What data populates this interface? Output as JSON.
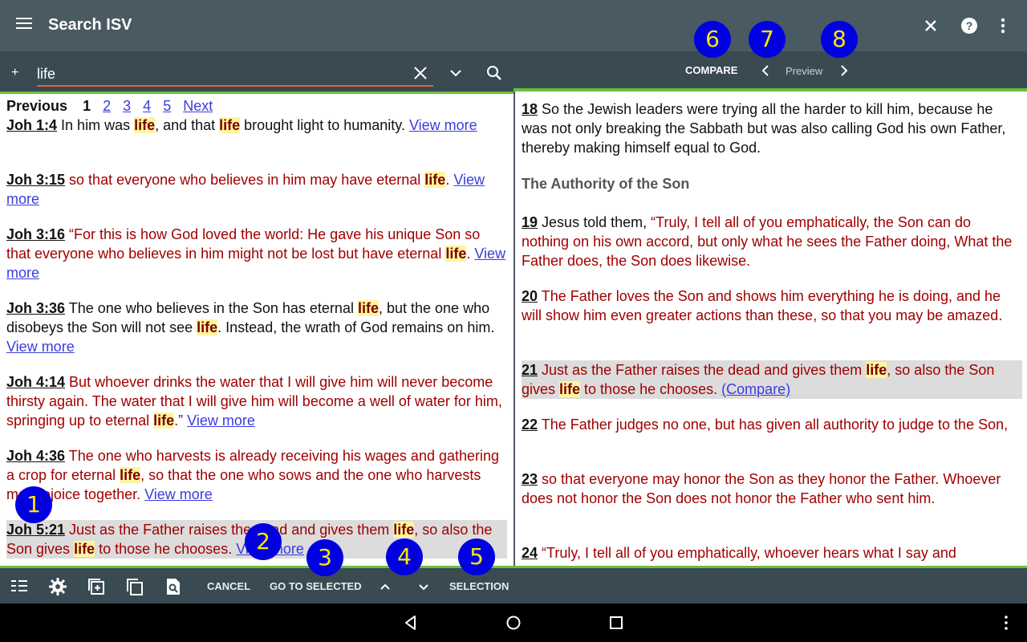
{
  "appbar": {
    "title": "Search ISV"
  },
  "search": {
    "value": "life"
  },
  "rightbar": {
    "compare_label": "COMPARE",
    "preview_label": "Preview"
  },
  "pager": {
    "previous": "Previous",
    "current": "1",
    "pages": [
      "2",
      "3",
      "4",
      "5"
    ],
    "next": "Next"
  },
  "results": [
    {
      "ref": "Joh 1:4",
      "p1": "In him was ",
      "h1": "life",
      "p2": ", and that ",
      "h2": "life",
      "p3": " brought light to humanity.",
      "view_more": "View more"
    },
    {
      "ref": "Joh 3:15",
      "p1": "so that everyone who believes in him may have eternal ",
      "h1": "life",
      "p2": ".",
      "view_more": "View more"
    },
    {
      "ref": "Joh 3:16",
      "p1": "“For this is how God loved the world: He gave his unique Son so that everyone who believes in him might not be lost but have eternal ",
      "h1": "life",
      "p2": ".",
      "view_more": "View more"
    },
    {
      "ref": "Joh 3:36",
      "p1": "The one who believes in the Son has eternal ",
      "h1": "life",
      "p2": ", but the one who disobeys the Son will not see ",
      "h2": "life",
      "p3": ". Instead, the wrath of God remains on him.",
      "view_more": "View more"
    },
    {
      "ref": "Joh 4:14",
      "p1": "But whoever drinks the water that I will give him will never become thirsty again. The water that I will give him will become a well of water for him, springing up to eternal ",
      "h1": "life",
      "p2": ".”",
      "view_more": "View more"
    },
    {
      "ref": "Joh 4:36",
      "p1": "The one who harvests is already receiving his wages and gathering a crop for eternal ",
      "h1": "life",
      "p2": ", so that the one who sows and the one who harvests may rejoice together.",
      "view_more": "View more"
    },
    {
      "ref": "Joh 5:21",
      "p1": "Just as the Father raises the dead and gives them ",
      "h1": "life",
      "p2": ", so also the Son gives ",
      "h2": "life",
      "p3": " to those he chooses.",
      "view_more": "View more"
    }
  ],
  "chapter": {
    "heading": "The Authority of the Son",
    "verses": [
      {
        "num": "18",
        "text": "So the Jewish leaders were trying all the harder to kill him, because he was not only breaking the Sabbath but was also calling God his own Father, thereby making himself equal to God."
      },
      {
        "num": "19",
        "black": "Jesus told them, ",
        "text": "“Truly, I tell all of you emphatically, the Son can do nothing on his own accord, but only what he sees the Father doing, What the Father does, the Son does likewise."
      },
      {
        "num": "20",
        "text": "The Father loves the Son and shows him everything he is doing, and he will show him even greater actions than these, so that you may be amazed."
      },
      {
        "num": "21",
        "p1": "Just as the Father raises the dead and gives them ",
        "h1": "life",
        "p2": ", so also the Son gives ",
        "h2": "life",
        "p3": " to those he chooses. ",
        "link": "(Compare)"
      },
      {
        "num": "22",
        "text": "The Father judges no one, but has given all authority to judge to the Son,"
      },
      {
        "num": "23",
        "text": "so that everyone may honor the Son as they honor the Father. Whoever does not honor the Son does not honor the Father who sent him."
      },
      {
        "num": "24",
        "text": "“Truly, I tell all of you emphatically, whoever hears what I say and"
      }
    ]
  },
  "bottombar": {
    "cancel": "CANCEL",
    "go_to_selected": "GO TO SELECTED",
    "selection": "SELECTION"
  },
  "badges": [
    "1",
    "2",
    "3",
    "4",
    "5",
    "6",
    "7",
    "8"
  ],
  "colors": {
    "appbar": "#4a5a62",
    "toolbar": "#394a52",
    "accent_green": "#6bbf3a",
    "highlight": "#fff59d",
    "verse_red": "#a00000",
    "link_blue": "#3b3be0",
    "badge_blue": "#0000e0",
    "badge_yellow": "#ffe600"
  }
}
